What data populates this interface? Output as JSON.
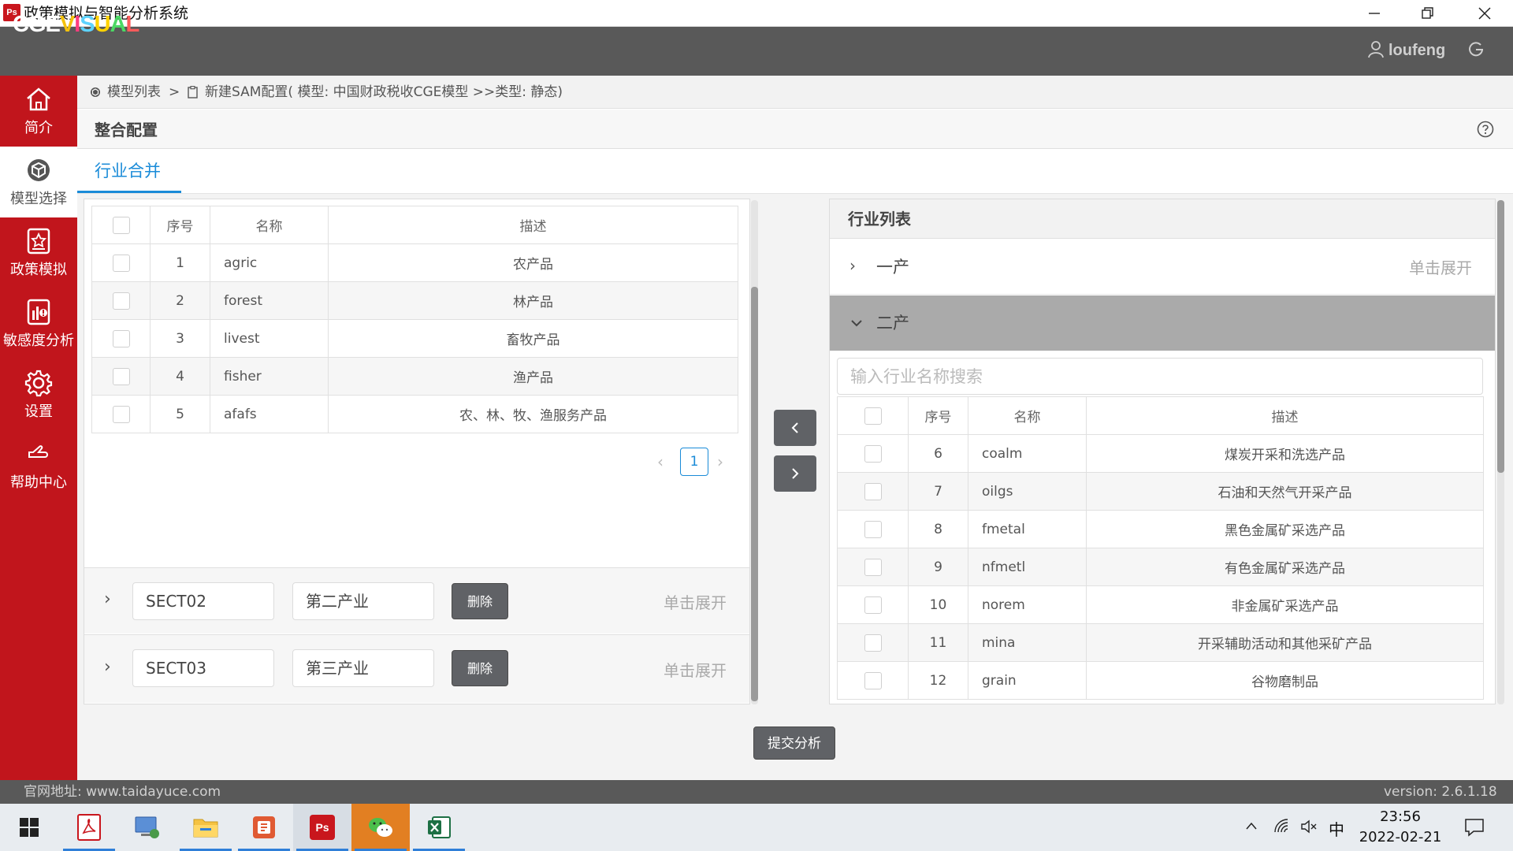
{
  "window": {
    "title": "政策模拟与智能分析系统",
    "app_icon_text": "Ps"
  },
  "header": {
    "logo": [
      "CGE",
      "V",
      "I",
      "S",
      "U",
      "A",
      "L"
    ],
    "logo_colors": [
      "#ffffff",
      "#f4c20d",
      "#ff3d7f",
      "#5dd3ff",
      "#ffd200",
      "#4cd964",
      "#ff5b5b"
    ],
    "username": "loufeng"
  },
  "sidebar": {
    "items": [
      {
        "label": "简介",
        "icon": "home-icon"
      },
      {
        "label": "模型选择",
        "icon": "cube-icon",
        "active": true
      },
      {
        "label": "政策模拟",
        "icon": "star-doc-icon"
      },
      {
        "label": "敏感度分析",
        "icon": "chart-alert-icon"
      },
      {
        "label": "设置",
        "icon": "gear-icon"
      },
      {
        "label": "帮助中心",
        "icon": "hand-icon"
      }
    ]
  },
  "breadcrumb": {
    "item1": "模型列表",
    "separator": ">",
    "item2": "新建SAM配置( 模型: 中国财政税收CGE模型 >>类型: 静态)"
  },
  "section": {
    "title": "整合配置"
  },
  "tab": {
    "label": "行业合并"
  },
  "left_table": {
    "headers": [
      "序号",
      "名称",
      "描述"
    ],
    "rows": [
      {
        "no": "1",
        "name": "agric",
        "desc": "农产品"
      },
      {
        "no": "2",
        "name": "forest",
        "desc": "林产品"
      },
      {
        "no": "3",
        "name": "livest",
        "desc": "畜牧产品"
      },
      {
        "no": "4",
        "name": "fisher",
        "desc": "渔产品"
      },
      {
        "no": "5",
        "name": "afafs",
        "desc": "农、林、牧、渔服务产品"
      }
    ],
    "page": "1"
  },
  "groups": [
    {
      "code": "SECT02",
      "name": "第二产业",
      "delete_label": "删除",
      "hint": "单击展开"
    },
    {
      "code": "SECT03",
      "name": "第三产业",
      "delete_label": "删除",
      "hint": "单击展开"
    }
  ],
  "transfer": {
    "left": "<",
    "right": ">"
  },
  "right_panel": {
    "title": "行业列表",
    "categories": [
      {
        "label": "一产",
        "hint": "单击展开",
        "expanded": false
      },
      {
        "label": "二产",
        "hint": "",
        "expanded": true
      }
    ],
    "search_placeholder": "输入行业名称搜索",
    "headers": [
      "序号",
      "名称",
      "描述"
    ],
    "rows": [
      {
        "no": "6",
        "name": "coalm",
        "desc": "煤炭开采和洗选产品"
      },
      {
        "no": "7",
        "name": "oilgs",
        "desc": "石油和天然气开采产品"
      },
      {
        "no": "8",
        "name": "fmetal",
        "desc": "黑色金属矿采选产品"
      },
      {
        "no": "9",
        "name": "nfmetl",
        "desc": "有色金属矿采选产品"
      },
      {
        "no": "10",
        "name": "norem",
        "desc": "非金属矿采选产品"
      },
      {
        "no": "11",
        "name": "mina",
        "desc": "开采辅助活动和其他采矿产品"
      },
      {
        "no": "12",
        "name": "grain",
        "desc": "谷物磨制品"
      }
    ]
  },
  "submit_label": "提交分析",
  "footer": {
    "site": "官网地址: www.taidayuce.com",
    "version": "version: 2.6.1.18"
  },
  "taskbar": {
    "ime": "中",
    "time": "23:56",
    "date": "2022-02-21"
  },
  "colors": {
    "sidebar": "#c1151c",
    "header": "#595959",
    "accent": "#1a8bd8",
    "button": "#606266"
  }
}
